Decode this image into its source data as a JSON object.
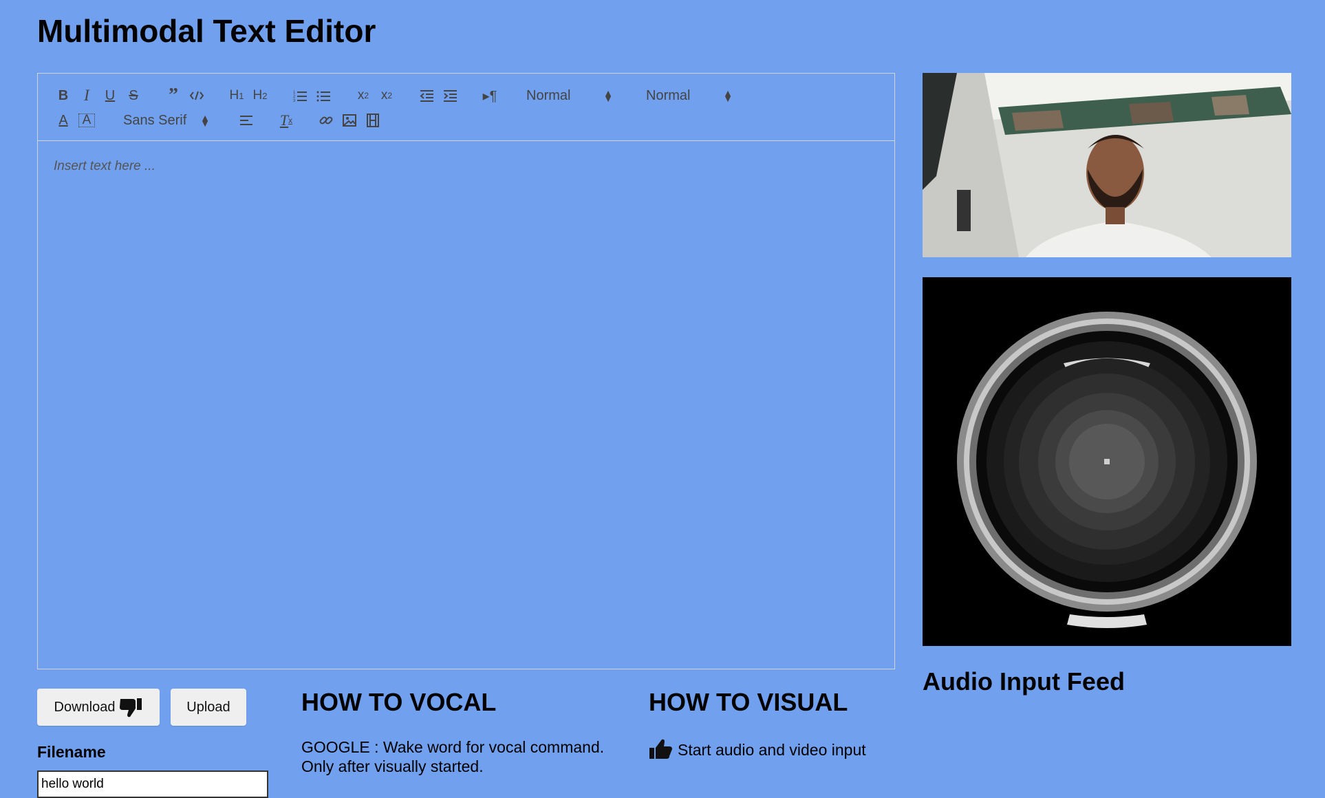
{
  "page": {
    "title": "Multimodal Text Editor"
  },
  "editor": {
    "placeholder": "Insert text here ...",
    "toolbar": {
      "header_select": "Normal",
      "size_select": "Normal",
      "font_select": "Sans Serif",
      "buttons": [
        "bold-icon",
        "italic-icon",
        "underline-icon",
        "strike-icon",
        "blockquote-icon",
        "code-block-icon",
        "h1-icon",
        "h2-icon",
        "ordered-list-icon",
        "bullet-list-icon",
        "subscript-icon",
        "superscript-icon",
        "outdent-icon",
        "indent-icon",
        "rtl-icon",
        "text-color-icon",
        "background-color-icon",
        "align-icon",
        "clean-format-icon",
        "link-icon",
        "image-icon",
        "video-icon"
      ]
    }
  },
  "actions": {
    "download_label": "Download",
    "upload_label": "Upload",
    "filename_label": "Filename",
    "filename_value": "hello world"
  },
  "howto_vocal": {
    "title": "HOW TO VOCAL",
    "description": "GOOGLE : Wake word for vocal command. Only after visually started."
  },
  "howto_visual": {
    "title": "HOW TO VISUAL",
    "items": [
      "Start audio and video input"
    ]
  },
  "media": {
    "audio_label": "Audio Input Feed"
  },
  "colors": {
    "background": "#71a0ef",
    "toolbar_icon": "#444444",
    "editor_border": "#d0d6dc"
  }
}
